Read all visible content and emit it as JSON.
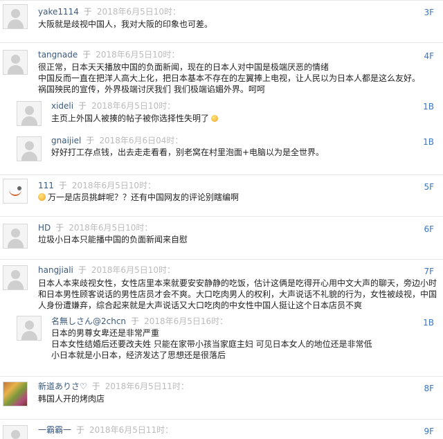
{
  "posts": [
    {
      "user": "yake1114",
      "yu": "于",
      "time": "2018年6月5日10时：",
      "floor": "3F",
      "lines": [
        "大阪就是歧视中国人，我对大阪的印象也可差。"
      ]
    },
    {
      "user": "tangnade",
      "yu": "于",
      "time": "2018年6月5日10时：",
      "floor": "4F",
      "lines": [
        "很正常，日本天天播放中国的负面新闻，现在的日本人对中国是极端厌恶的情绪",
        "中国反而一直在把洋人高大上化，把日本基本不存在的左翼捧上电视，让人民以为日本人都是这么友好。",
        "祸国殃民的宣传，外界极端讨厌我们 我们极端谄媚外界。呵呵"
      ]
    },
    {
      "user": "xideli",
      "yu": "于",
      "time": "2018年6月5日10时：",
      "floor": "1B",
      "line_a": "主页上外国人被揍的帖子被你选择性失明了"
    },
    {
      "user": "gnaijiel",
      "yu": "于",
      "time": "2018年6月6日04时：",
      "floor": "1B",
      "lines": [
        "好好打工存点钱，出去走走看看，别老窝在村里泡面+电脑以为是全世界。"
      ]
    },
    {
      "user": "111",
      "yu": "于",
      "time": "2018年6月5日10时：",
      "floor": "5F",
      "line_a": "万一是店员挑衅呢？？还有中国网友的评论别瞎编啊"
    },
    {
      "user": "HD",
      "yu": "于",
      "time": "2018年6月5日10时：",
      "floor": "6F",
      "lines": [
        "垃圾小日本只能播中国的负面新闻来自慰"
      ]
    },
    {
      "user": "hangjiali",
      "yu": "于",
      "time": "2018年6月5日10时：",
      "floor": "7F",
      "lines": [
        "日本人本来歧视女性，女性店里本来就要安安静静的吃饭，估计这俩是吃得开心用中文大声的聊天，旁边小时",
        "和日本男性顾客说话的男性店员才会不爽。大口吃肉男人的权利，大声说话不礼貌的行为，女性被歧视，中国",
        "人身份遭嫌弃，综合起来就是大声说话又大口吃肉的中女性中国人挺让这个日本店员不爽"
      ]
    },
    {
      "user": "名無しさん@2chcn",
      "yu": "于",
      "time": "2018年6月5日16时：",
      "floor": "1B",
      "lines": [
        "日本的男尊女卑还是非常严重",
        "日本女性结婚后还要改夫姓 只能在家带小孩当家庭主妇 可见日本女人的地位还是非常低",
        "小日本就是小日本，经济发达了思想还是很落后"
      ]
    },
    {
      "user": "新道ありさ♡",
      "yu": "于",
      "time": "2018年6月5日11时：",
      "floor": "8F",
      "lines": [
        "韩国人开的烤肉店"
      ]
    },
    {
      "user": "一霸霸一",
      "yu": "于",
      "time": "2018年6月5日11时：",
      "floor": "9F",
      "lines": []
    }
  ]
}
